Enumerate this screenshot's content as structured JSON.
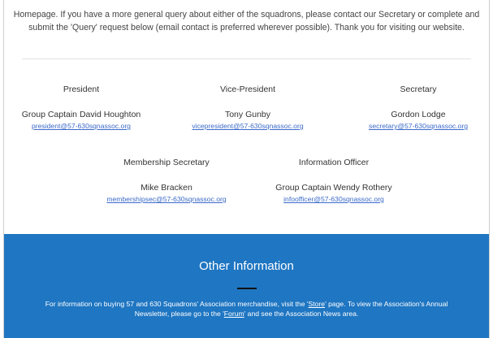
{
  "intro": {
    "line1": "Homepage. If you have a more general query about either of the squadrons, please contact our Secretary or complete and",
    "line2": "submit the 'Query' request below (email contact is preferred wherever possible). Thank you for visiting our website."
  },
  "contacts": [
    {
      "role": "President",
      "name": "Group Captain David Houghton",
      "email": "president@57-630sqnassoc.org"
    },
    {
      "role": "Vice-President",
      "name": "Tony Gunby",
      "email": "vicepresident@57-630sqnassoc.org"
    },
    {
      "role": "Secretary",
      "name": "Gordon Lodge",
      "email": "secretary@57-630sqnassoc.org"
    },
    {
      "role": "Membership Secretary",
      "name": "Mike Bracken",
      "email": "membershipsec@57-630sqnassoc.org"
    },
    {
      "role": "Information Officer",
      "name": "Group Captain Wendy Rothery",
      "email": "infoofficer@57-630sqnassoc.org"
    }
  ],
  "other_info": {
    "title": "Other Information",
    "text_a": "For information on buying 57 and 630 Squadrons' Association merchandise, visit the '",
    "store_link": "Store",
    "text_b": "' page. To view the Association's Annual",
    "text_c": "Newsletter, please go to the '",
    "forum_link": "Forum",
    "text_d": "' and see the Association News area."
  },
  "colors": {
    "accent_blue": "#1f76c2",
    "link_blue": "#3b6ac9"
  }
}
